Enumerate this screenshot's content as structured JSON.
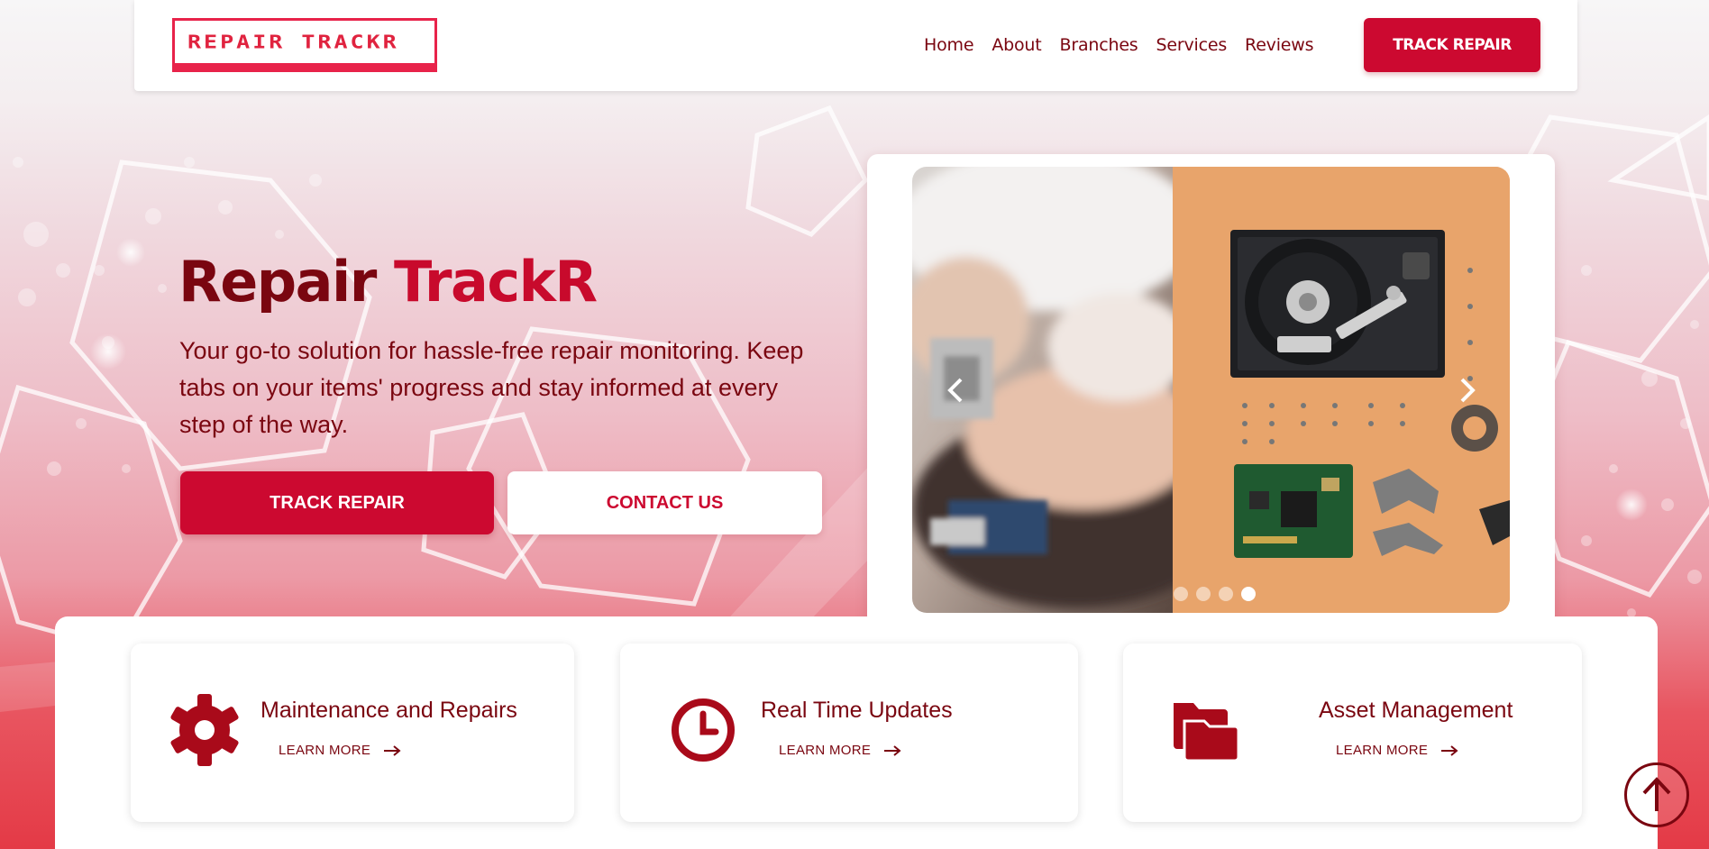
{
  "brand": {
    "logo_text": "REPAIR TRACKR"
  },
  "nav": {
    "links": [
      "Home",
      "About",
      "Branches",
      "Services",
      "Reviews"
    ],
    "cta": "TRACK REPAIR"
  },
  "hero": {
    "title_main": "Repair",
    "title_accent": "TrackR",
    "description": "Your go-to solution for hassle-free repair monitoring. Keep tabs on your items' progress and stay informed at every step of the way.",
    "primary_button": "TRACK REPAIR",
    "secondary_button": "CONTACT US"
  },
  "carousel": {
    "slide_count": 4,
    "active_slide": 4,
    "prev_icon": "chevron-left-icon",
    "next_icon": "chevron-right-icon"
  },
  "features": [
    {
      "title": "Maintenance and Repairs",
      "link": "LEARN MORE",
      "icon": "gear-icon"
    },
    {
      "title": "Real Time Updates",
      "link": "LEARN MORE",
      "icon": "clock-icon"
    },
    {
      "title": "Asset Management",
      "link": "LEARN MORE",
      "icon": "folders-icon"
    }
  ],
  "colors": {
    "primary": "#cc0930",
    "dark_red": "#7a0610",
    "logo": "#e8234a",
    "panel": "#ffffff"
  },
  "scroll_top_icon": "arrow-up-circle-icon"
}
